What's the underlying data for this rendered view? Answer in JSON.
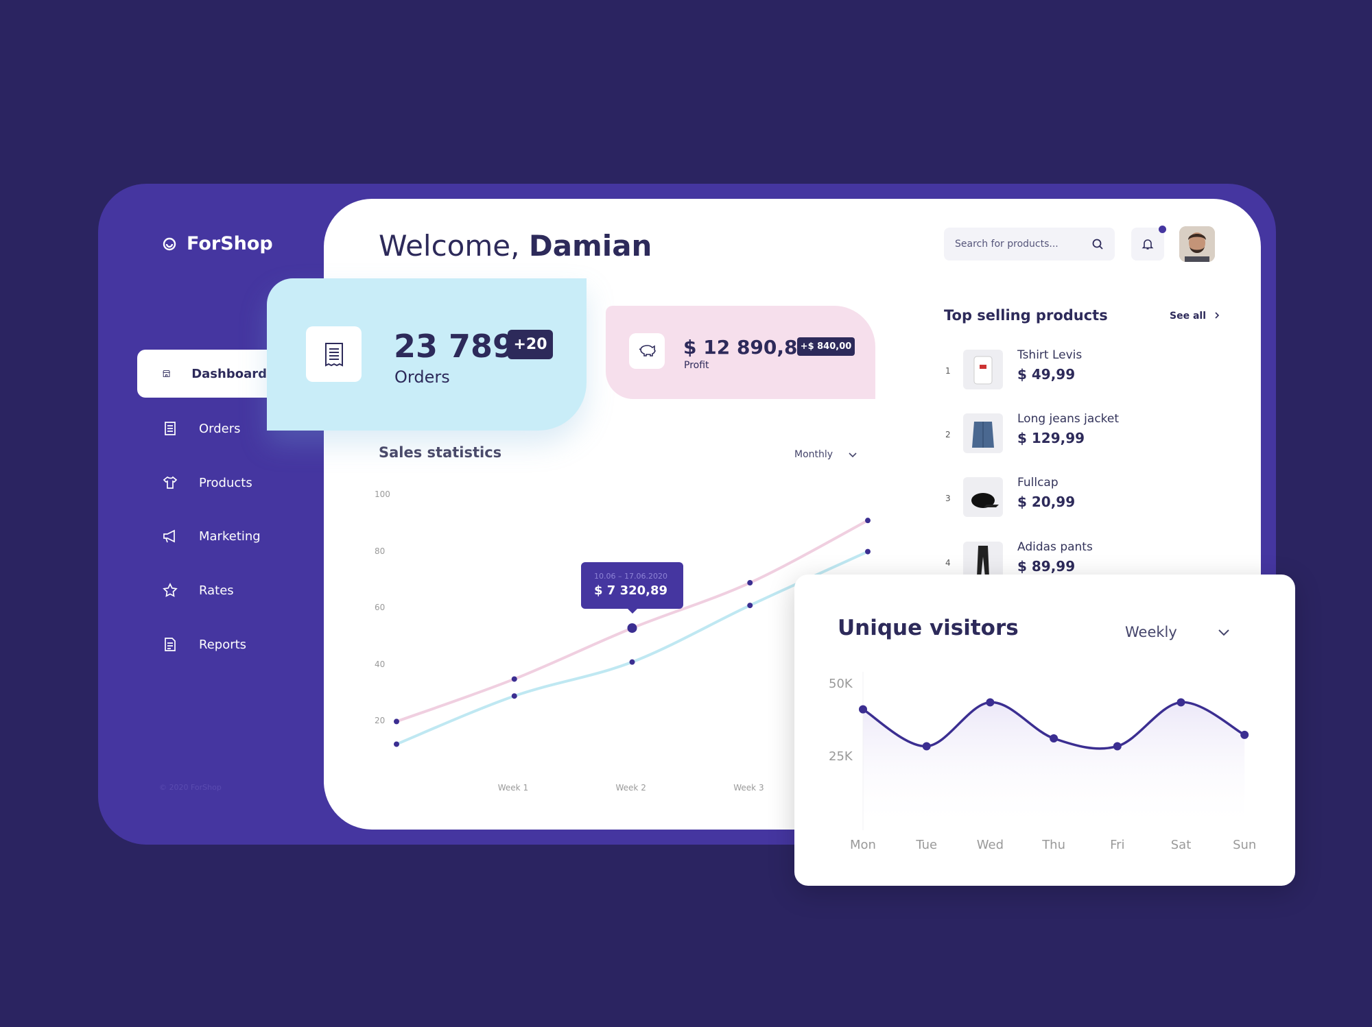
{
  "app": {
    "name": "ForShop",
    "copyright": "© 2020 ForShop"
  },
  "sidebar": {
    "items": [
      {
        "label": "Dashboard",
        "icon": "store-icon",
        "active": true
      },
      {
        "label": "Orders",
        "icon": "receipt-icon"
      },
      {
        "label": "Products",
        "icon": "tshirt-icon"
      },
      {
        "label": "Marketing",
        "icon": "megaphone-icon"
      },
      {
        "label": "Rates",
        "icon": "star-icon"
      },
      {
        "label": "Reports",
        "icon": "report-icon"
      }
    ]
  },
  "header": {
    "greeting": "Welcome,",
    "user": "Damian",
    "search_placeholder": "Search for products..."
  },
  "colors": {
    "background": "#2b2461",
    "brand": "#4536a0",
    "dark": "#2d2a5a",
    "orders_card": "#c9edf8",
    "profit_card": "#f6dfec",
    "series_pink": "#f0cfe0",
    "series_cyan": "#bfe8f2"
  },
  "stats": {
    "orders": {
      "value": "23 789",
      "delta": "+20",
      "label": "Orders"
    },
    "profit": {
      "value": "$ 12 890,89",
      "delta": "+$ 840,00",
      "label": "Profit"
    }
  },
  "sales": {
    "title": "Sales statistics",
    "period": "Monthly",
    "tooltip": {
      "date": "10.06 – 17.06.2020",
      "value": "$ 7 320,89"
    }
  },
  "top_products": {
    "title": "Top selling products",
    "see_all": "See all",
    "items": [
      {
        "rank": "1",
        "name": "Tshirt Levis",
        "price": "$ 49,99"
      },
      {
        "rank": "2",
        "name": "Long jeans jacket",
        "price": "$ 129,99"
      },
      {
        "rank": "3",
        "name": "Fullcap",
        "price": "$ 20,99"
      },
      {
        "rank": "4",
        "name": "Adidas pants",
        "price": "$ 89,99"
      }
    ]
  },
  "visitors": {
    "title": "Unique visitors",
    "period": "Weekly"
  },
  "chart_data": [
    {
      "type": "line",
      "title": "Sales statistics",
      "x": [
        "",
        "Week 1",
        "Week 2",
        "Week 3",
        ""
      ],
      "yticks": [
        "100",
        "80",
        "60",
        "40",
        "20"
      ],
      "ylim": [
        0,
        100
      ],
      "grid": false,
      "series": [
        {
          "values": [
            20,
            35,
            53,
            69,
            91
          ],
          "color": "#f0cfe0"
        },
        {
          "values": [
            12,
            29,
            41,
            61,
            80
          ],
          "color": "#bfe8f2"
        }
      ],
      "highlight": {
        "series": 0,
        "index": 2
      }
    },
    {
      "type": "area",
      "title": "Unique visitors",
      "categories": [
        "Mon",
        "Tue",
        "Wed",
        "Thu",
        "Fri",
        "Sat",
        "Sun"
      ],
      "yticks": [
        "50K",
        "25K"
      ],
      "ylim": [
        0,
        50000
      ],
      "values": [
        41600,
        28900,
        44000,
        31600,
        28900,
        44000,
        32800
      ],
      "color": "#3b2e91"
    }
  ]
}
